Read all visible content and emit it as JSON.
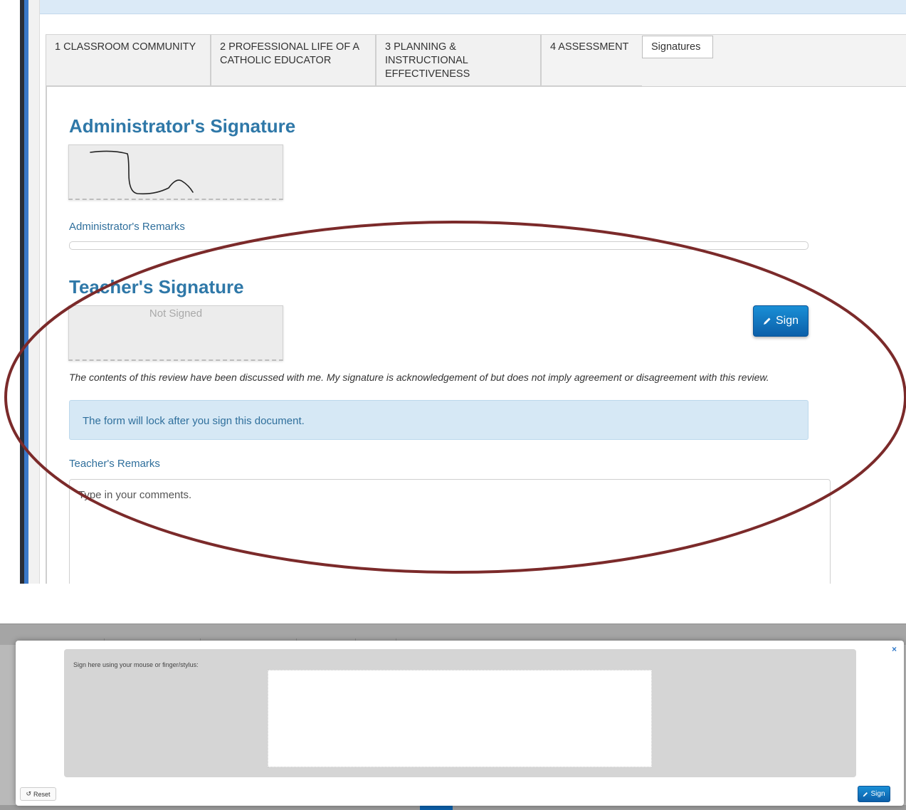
{
  "tabs": [
    {
      "label": "1 CLASSROOM COMMUNITY"
    },
    {
      "label": "2 PROFESSIONAL LIFE OF A CATHOLIC EDUCATOR"
    },
    {
      "label": "3 PLANNING & INSTRUCTIONAL EFFECTIVENESS"
    },
    {
      "label": "4 ASSESSMENT"
    },
    {
      "label": "Signatures"
    }
  ],
  "administrator": {
    "title": "Administrator's Signature",
    "remarks_label": "Administrator's Remarks"
  },
  "teacher": {
    "title": "Teacher's Signature",
    "not_signed": "Not Signed",
    "sign_button": "Sign",
    "disclaimer": "The contents of this review have been discussed with me. My signature is acknowledgement of but does not imply agreement or disagreement with this review.",
    "lock_notice": "The form will lock after you sign this document.",
    "remarks_label": "Teacher's Remarks",
    "remarks_placeholder": "Type in your comments."
  },
  "modal": {
    "close_glyph": "×",
    "hint": "Sign here using your mouse or finger/stylus:",
    "reset_label": "Reset",
    "sign_label": "Sign"
  },
  "colors": {
    "heading_blue": "#2f78a8",
    "button_blue": "#0b5fa9",
    "annotation_ellipse": "#7b2a2a",
    "alert_bg": "#d6e8f5"
  },
  "icons": {
    "sign_button": "pencil-icon",
    "reset_button": "undo-icon",
    "modal_close": "close-icon"
  }
}
